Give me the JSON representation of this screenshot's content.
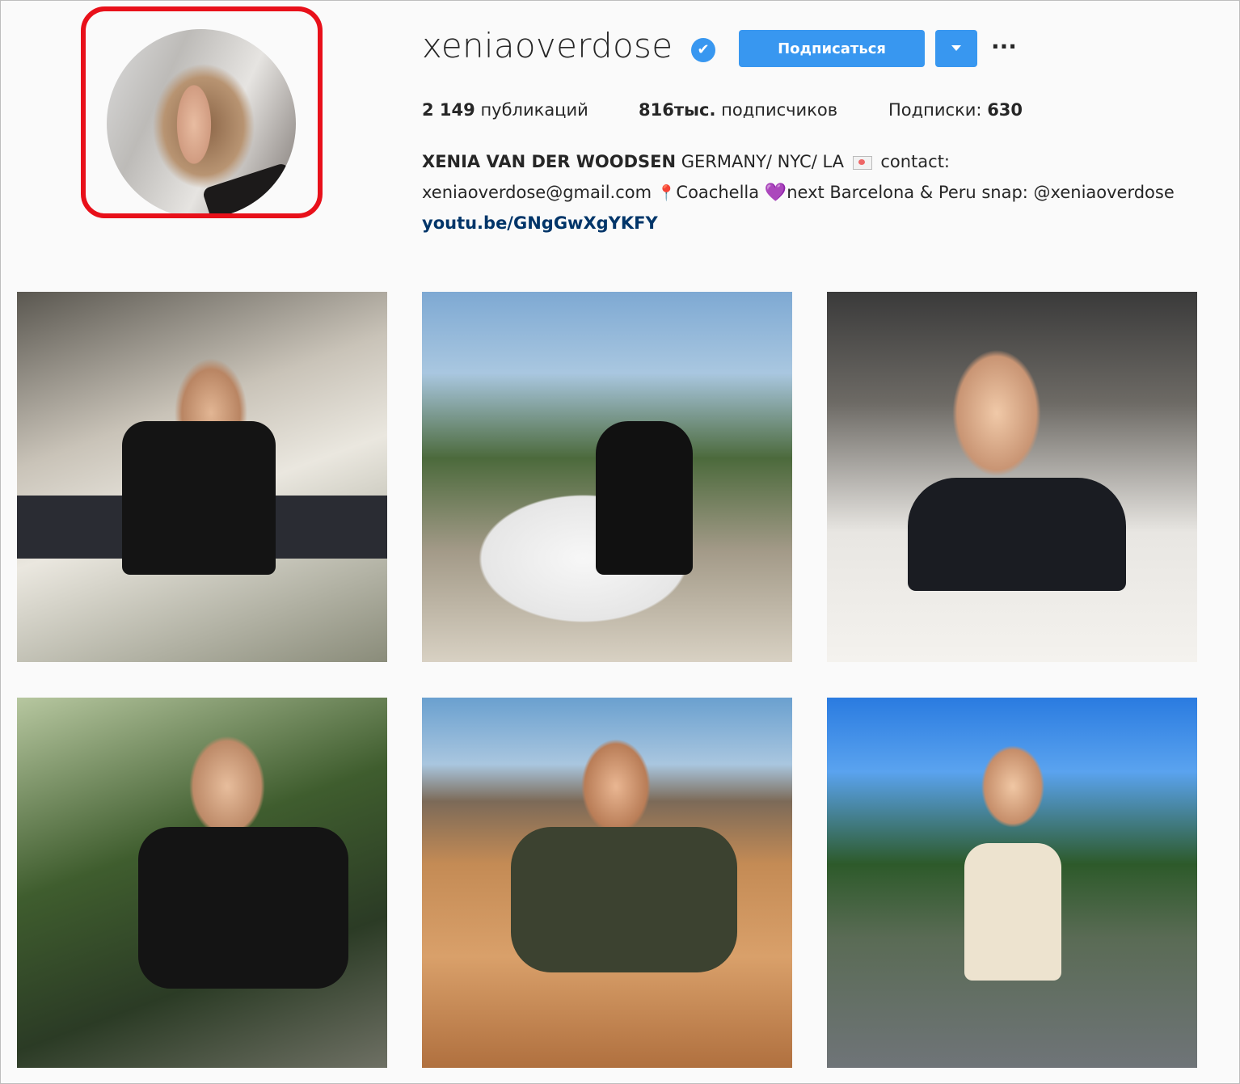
{
  "profile": {
    "username": "xeniaoverdose",
    "verified_icon": "✔",
    "follow_label": "Подписаться",
    "more_label": "···",
    "posts_count": "2 149",
    "posts_label": "публикаций",
    "followers_count": "816тыс.",
    "followers_label": "подписчиков",
    "following_label": "Подписки:",
    "following_count": "630"
  },
  "bio": {
    "name": "XENIA VAN DER WOODSEN",
    "line1_rest": " GERMANY/ NYC/ LA ",
    "line1_end": " contact:",
    "email": "xeniaoverdose@gmail.com ",
    "pin": "📍",
    "coachella": "Coachella ",
    "heart": "💜",
    "line2_rest": "next Barcelona & Peru snap: @xeniaoverdose",
    "link": "youtu.be/GNgGwXgYKFY"
  },
  "colors": {
    "accent": "#3897f0",
    "highlight": "#e8101a",
    "link": "#003569"
  },
  "posts": [
    {
      "id": "post-1"
    },
    {
      "id": "post-2"
    },
    {
      "id": "post-3"
    },
    {
      "id": "post-4"
    },
    {
      "id": "post-5"
    },
    {
      "id": "post-6"
    }
  ]
}
